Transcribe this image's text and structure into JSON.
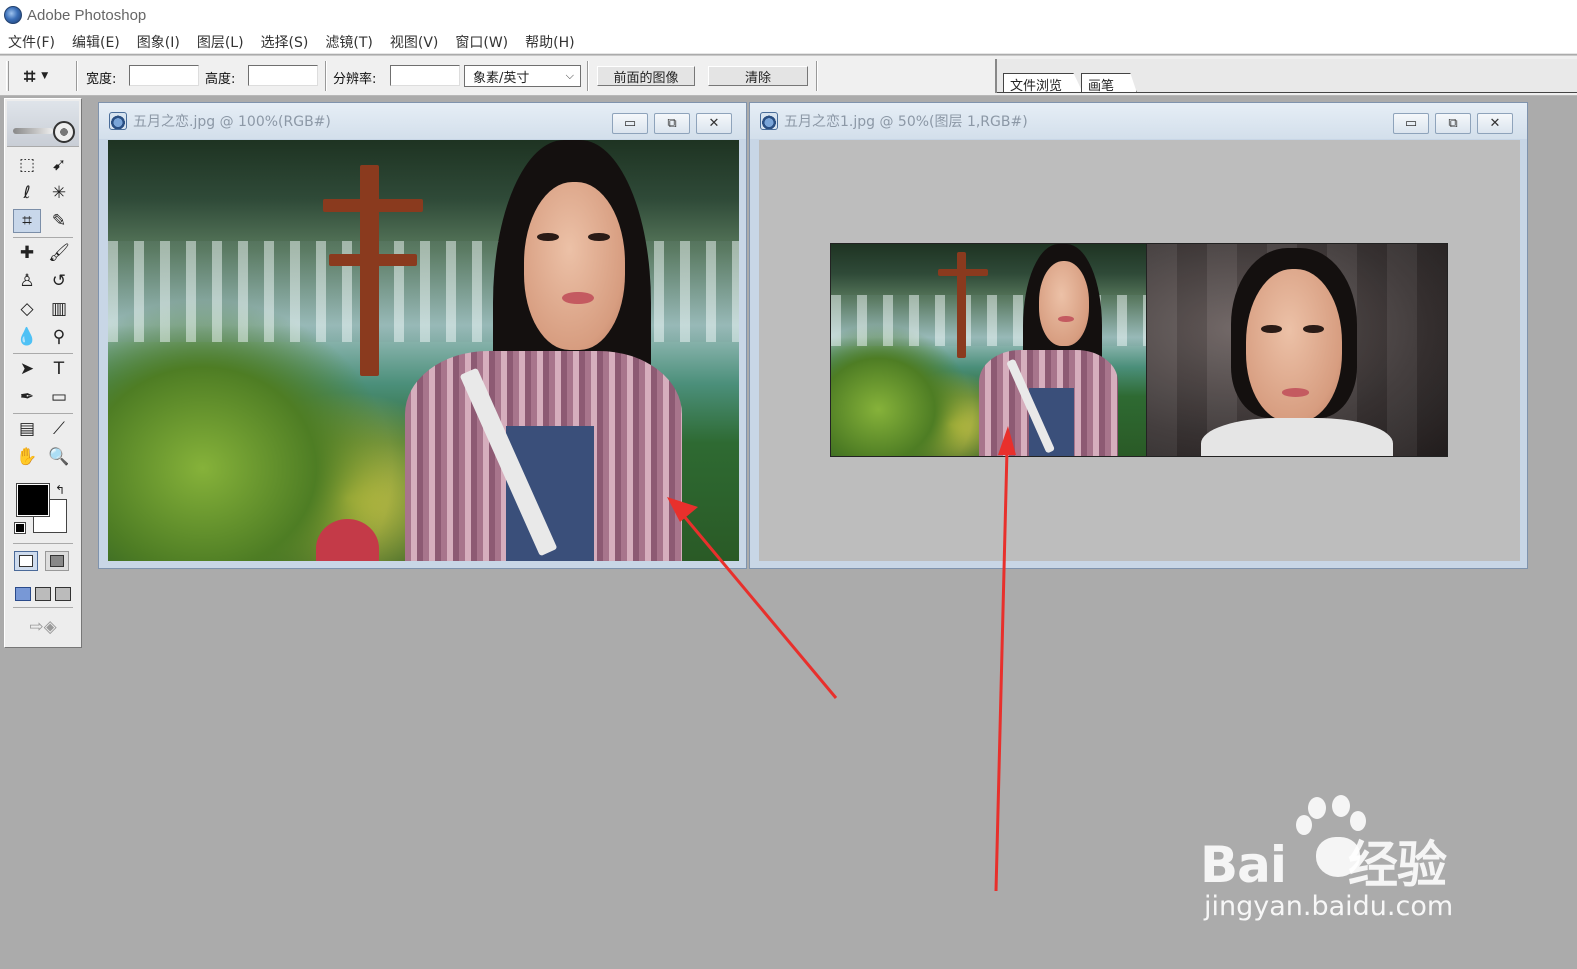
{
  "app": {
    "title": "Adobe Photoshop"
  },
  "menu": [
    "文件(F)",
    "编辑(E)",
    "图象(I)",
    "图层(L)",
    "选择(S)",
    "滤镜(T)",
    "视图(V)",
    "窗口(W)",
    "帮助(H)"
  ],
  "options": {
    "width_label": "宽度:",
    "width_value": "",
    "height_label": "高度:",
    "height_value": "",
    "resolution_label": "分辨率:",
    "resolution_value": "",
    "unit": "象素/英寸",
    "front_image_button": "前面的图像",
    "clear_button": "清除"
  },
  "palette_well": {
    "tabs": [
      "文件浏览",
      "画笔"
    ]
  },
  "documents": [
    {
      "title": "五月之恋.jpg @ 100%(RGB#)"
    },
    {
      "title": "五月之恋1.jpg @ 50%(图层 1,RGB#)"
    }
  ],
  "window_controls": {
    "minimize": "▭",
    "restore": "⧉",
    "close": "✕"
  },
  "toolbox": {
    "tools": [
      "rectangular-marquee",
      "move",
      "lasso",
      "magic-wand",
      "crop",
      "slice",
      "healing-brush",
      "brush",
      "clone-stamp",
      "history-brush",
      "eraser",
      "gradient",
      "blur",
      "dodge",
      "path-selection",
      "type",
      "pen",
      "rectangle-shape",
      "notes",
      "eyedropper",
      "hand",
      "zoom"
    ],
    "active_tool": "crop",
    "foreground_color": "#000000",
    "background_color": "#ffffff"
  },
  "annotation": {
    "arrow_color": "#e8302c"
  },
  "watermark": {
    "brand": "Bai",
    "brand_suffix": "经验",
    "url": "jingyan.baidu.com"
  }
}
